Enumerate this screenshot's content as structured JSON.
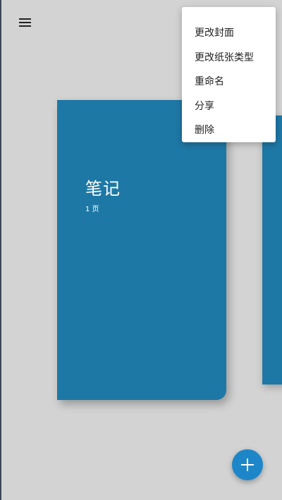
{
  "toolbar": {
    "menu_icon": "hamburger-menu-icon"
  },
  "notebooks": [
    {
      "title": "笔记",
      "pages": "1 页",
      "cover_color": "#1e78a5"
    }
  ],
  "context_menu": {
    "items": [
      "更改封面",
      "更改纸张类型",
      "重命名",
      "分享",
      "删除"
    ]
  },
  "fab": {
    "icon": "plus-icon",
    "color": "#1d86c9"
  }
}
